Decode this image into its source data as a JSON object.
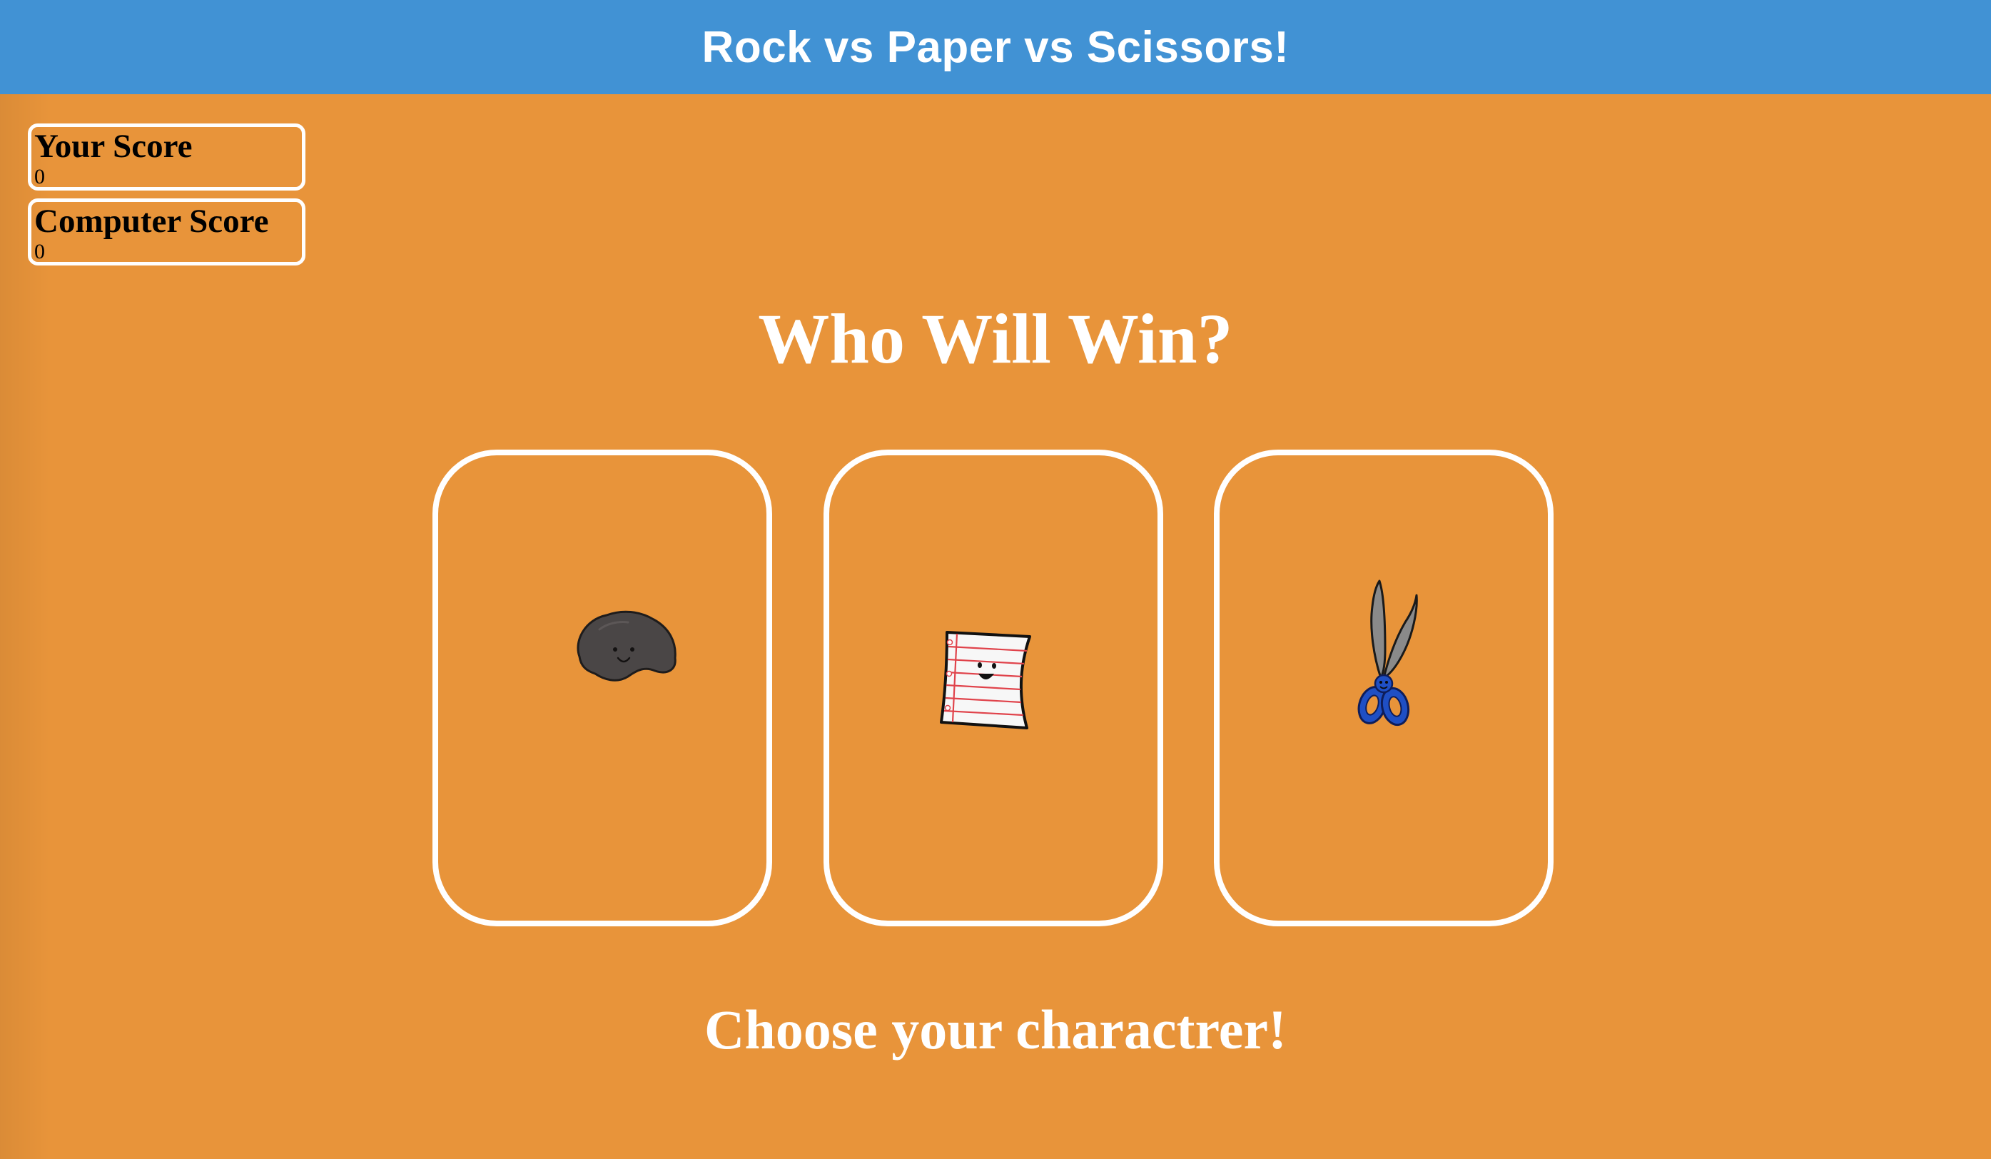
{
  "header": {
    "title": "Rock vs Paper vs Scissors!"
  },
  "scores": {
    "player": {
      "label": "Your Score",
      "value": "0"
    },
    "computer": {
      "label": "Computer Score",
      "value": "0"
    }
  },
  "main": {
    "headline": "Who Will Win?",
    "prompt": "Choose your charactrer!"
  },
  "choices": [
    {
      "id": "rock",
      "icon": "rock-icon"
    },
    {
      "id": "paper",
      "icon": "paper-icon"
    },
    {
      "id": "scissors",
      "icon": "scissors-icon"
    }
  ],
  "colors": {
    "header_bg": "#4192D4",
    "page_bg": "#E8943A",
    "card_border": "#FFFFFF",
    "text_light": "#FFFFFF"
  }
}
